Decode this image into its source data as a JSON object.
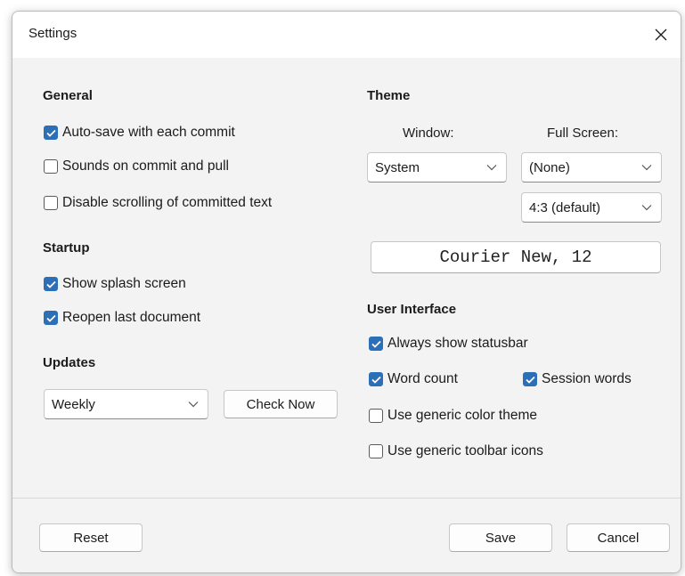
{
  "window": {
    "title": "Settings"
  },
  "general": {
    "heading": "General",
    "items": [
      {
        "label": "Auto-save with each commit",
        "checked": true
      },
      {
        "label": "Sounds on commit and pull",
        "checked": false
      },
      {
        "label": "Disable scrolling of committed text",
        "checked": false
      }
    ]
  },
  "startup": {
    "heading": "Startup",
    "items": [
      {
        "label": "Show splash screen",
        "checked": true
      },
      {
        "label": "Reopen last document",
        "checked": true
      }
    ]
  },
  "updates": {
    "heading": "Updates",
    "frequency": "Weekly",
    "check_now": "Check Now"
  },
  "theme": {
    "heading": "Theme",
    "window_label": "Window:",
    "fullscreen_label": "Full Screen:",
    "window_value": "System",
    "fullscreen_value": "(None)",
    "aspect_value": "4:3 (default)",
    "font": "Courier New, 12"
  },
  "ui": {
    "heading": "User Interface",
    "items": [
      {
        "label": "Always show statusbar",
        "checked": true
      },
      {
        "label": "Word count",
        "checked": true
      },
      {
        "label": "Session words",
        "checked": true
      },
      {
        "label": "Use generic color theme",
        "checked": false
      },
      {
        "label": "Use generic toolbar icons",
        "checked": false
      }
    ]
  },
  "footer": {
    "reset": "Reset",
    "save": "Save",
    "cancel": "Cancel"
  },
  "colors": {
    "accent": "#2c6fb7",
    "dialog_bg": "#f3f3f3"
  },
  "icons": {
    "close": "close-icon",
    "dropdown": "chevron-down-icon",
    "check": "checkmark-icon"
  }
}
